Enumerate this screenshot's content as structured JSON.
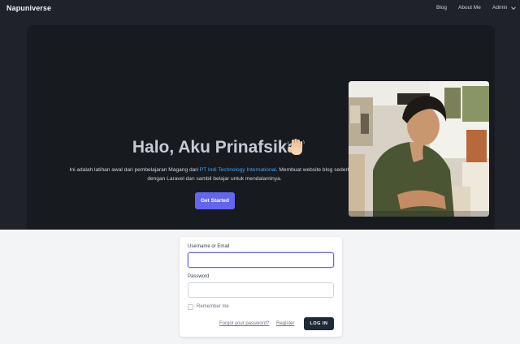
{
  "navbar": {
    "brand": "Napuniverse",
    "links": [
      "Blog",
      "About Me",
      "Admin"
    ]
  },
  "hero": {
    "title": "Halo, Aku Prinafsika",
    "wave_icon": "waving-hand-icon",
    "desc_pre": "Ini adalah latihan awal dari pembelajaran Magang dari ",
    "desc_link": "PT Indi Technology International",
    "desc_post": ". Membuat website blog sederhana dengan Laravel dan sambil belajar untuk mendalaminya.",
    "cta": "Get Started"
  },
  "login": {
    "username_label": "Username or Email",
    "username_value": "",
    "password_label": "Password",
    "password_value": "",
    "remember_label": "Remember me",
    "remember_checked": false,
    "forgot_link": "Forgot your password?",
    "register_link": "Register",
    "submit": "LOG IN"
  },
  "colors": {
    "nav_bg": "#1f2329",
    "hero_bg": "#171a1e",
    "accent": "#6366f1",
    "link": "#42a5f5",
    "page_bg": "#f3f4f6",
    "button_dark": "#1f2937"
  }
}
